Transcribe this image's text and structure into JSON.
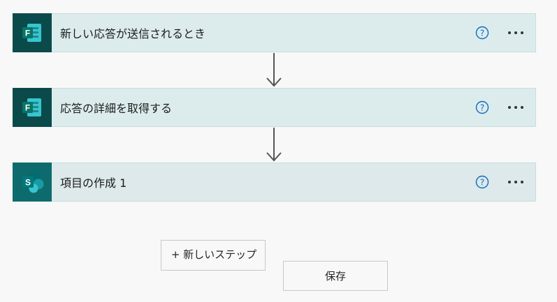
{
  "steps": [
    {
      "title": "新しい応答が送信されるとき",
      "app_icon": "forms-icon"
    },
    {
      "title": "応答の詳細を取得する",
      "app_icon": "forms-icon"
    },
    {
      "title": "項目の作成 1",
      "app_icon": "sharepoint-icon"
    }
  ],
  "step_actions": {
    "help_icon": "help-icon",
    "more_icon": "more-options-icon"
  },
  "icons": {
    "forms_letter": "F",
    "sharepoint_letter": "S"
  },
  "buttons": {
    "new_step_label": "+ 新しいステップ",
    "save_label": "保存"
  },
  "colors": {
    "card_bg": "#dceced",
    "forms_icon_bg": "#0b4a4a",
    "sharepoint_icon_bg": "#0e6b6d",
    "help_icon": "#0f6cbd",
    "arrow": "#555555"
  }
}
